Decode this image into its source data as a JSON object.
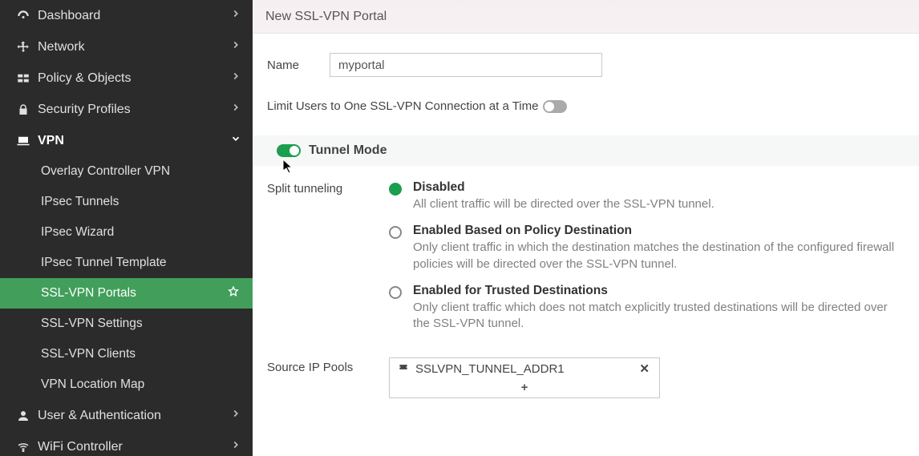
{
  "sidebar": {
    "top": [
      {
        "label": "Dashboard",
        "icon": "dashboard",
        "expanded": false
      },
      {
        "label": "Network",
        "icon": "move",
        "expanded": false
      },
      {
        "label": "Policy & Objects",
        "icon": "grid",
        "expanded": false
      },
      {
        "label": "Security Profiles",
        "icon": "lock",
        "expanded": false
      },
      {
        "label": "VPN",
        "icon": "laptop",
        "expanded": true,
        "children": [
          {
            "label": "Overlay Controller VPN",
            "active": false
          },
          {
            "label": "IPsec Tunnels",
            "active": false
          },
          {
            "label": "IPsec Wizard",
            "active": false
          },
          {
            "label": "IPsec Tunnel Template",
            "active": false
          },
          {
            "label": "SSL-VPN Portals",
            "active": true,
            "star": true
          },
          {
            "label": "SSL-VPN Settings",
            "active": false
          },
          {
            "label": "SSL-VPN Clients",
            "active": false
          },
          {
            "label": "VPN Location Map",
            "active": false
          }
        ]
      },
      {
        "label": "User & Authentication",
        "icon": "user",
        "expanded": false
      },
      {
        "label": "WiFi Controller",
        "icon": "wifi",
        "expanded": false
      }
    ]
  },
  "page": {
    "title": "New SSL-VPN Portal",
    "name_label": "Name",
    "name_value": "myportal",
    "limit_label": "Limit Users to One SSL-VPN Connection at a Time",
    "limit_on": false,
    "tunnel_section_label": "Tunnel Mode",
    "tunnel_on": true,
    "split_label": "Split tunneling",
    "split_options": [
      {
        "title": "Disabled",
        "desc": "All client traffic will be directed over the SSL-VPN tunnel.",
        "selected": true
      },
      {
        "title": "Enabled Based on Policy Destination",
        "desc": "Only client traffic in which the destination matches the destination of the configured firewall policies will be directed over the SSL-VPN tunnel.",
        "selected": false
      },
      {
        "title": "Enabled for Trusted Destinations",
        "desc": "Only client traffic which does not match explicitly trusted destinations will be directed over the SSL-VPN tunnel.",
        "selected": false
      }
    ],
    "pool_label": "Source IP Pools",
    "pool_entries": [
      {
        "name": "SSLVPN_TUNNEL_ADDR1"
      }
    ],
    "pool_add": "+"
  }
}
